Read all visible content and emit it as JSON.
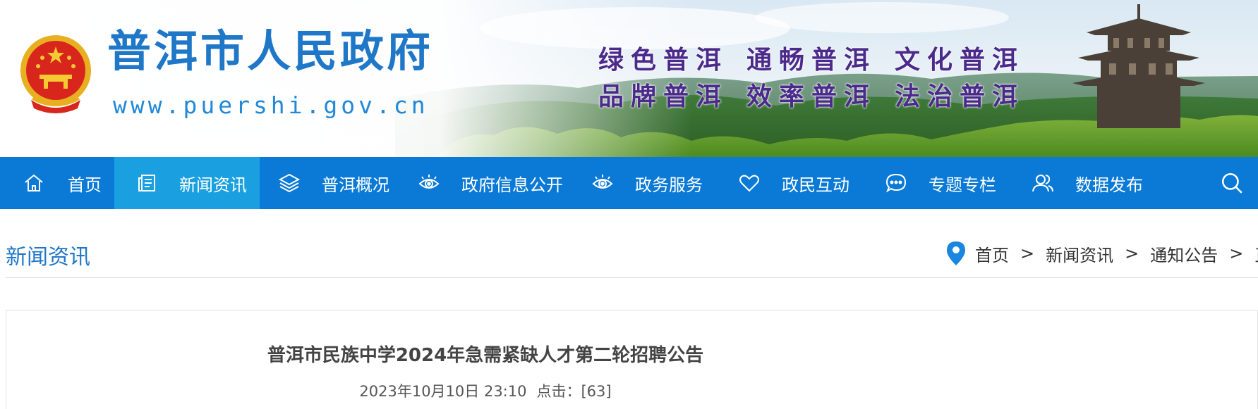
{
  "header": {
    "site_name": "普洱市人民政府",
    "site_url": "www.puershi.gov.cn",
    "slogans": [
      [
        "绿色普洱",
        "通畅普洱",
        "文化普洱"
      ],
      [
        "品牌普洱",
        "效率普洱",
        "法治普洱"
      ]
    ]
  },
  "nav": {
    "items": [
      {
        "label": "首页",
        "icon": "home-icon"
      },
      {
        "label": "新闻资讯",
        "icon": "news-icon",
        "active": true
      },
      {
        "label": "普洱概况",
        "icon": "layers-icon"
      },
      {
        "label": "政府信息公开",
        "icon": "eye-icon"
      },
      {
        "label": "政务服务",
        "icon": "eye-icon"
      },
      {
        "label": "政民互动",
        "icon": "heart-icon"
      },
      {
        "label": "专题专栏",
        "icon": "chat-bubble-icon"
      },
      {
        "label": "数据发布",
        "icon": "users-icon"
      }
    ],
    "search_icon": "search-icon"
  },
  "section": {
    "title": "新闻资讯"
  },
  "breadcrumb": {
    "items": [
      "首页",
      "新闻资讯",
      "通知公告",
      "正"
    ],
    "separator": ">"
  },
  "article": {
    "title": "普洱市民族中学2024年急需紧缺人才第二轮招聘公告",
    "datetime": "2023年10月10日 23:10",
    "clicks_label": "点击：",
    "clicks_value": "[63]"
  },
  "colors": {
    "nav_bg": "#0a7ad6",
    "nav_active": "#1aa0e0",
    "brand_blue": "#1f77c8",
    "slogan_purple": "#4b2a8c"
  }
}
